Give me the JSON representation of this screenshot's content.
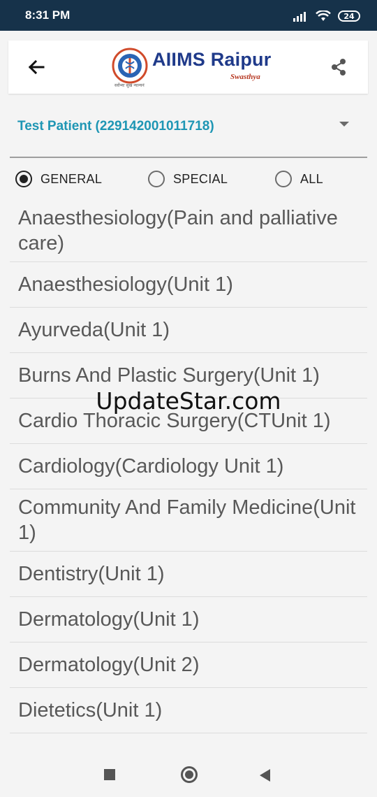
{
  "status_bar": {
    "time": "8:31 PM",
    "battery": "24"
  },
  "header": {
    "logo_title": "AIIMS Raipur",
    "logo_subtitle": "Swasthya",
    "logo_tagline": "सर्वेभ्यः सुखं न्यान्यनं"
  },
  "patient": {
    "selected": "Test Patient (229142001011718)"
  },
  "filter": {
    "options": [
      {
        "label": "GENERAL",
        "checked": true
      },
      {
        "label": "SPECIAL",
        "checked": false
      },
      {
        "label": "ALL",
        "checked": false
      }
    ]
  },
  "departments": [
    "Anaesthesiology(Pain and palliative care)",
    "Anaesthesiology(Unit 1)",
    "Ayurveda(Unit 1)",
    "Burns And Plastic Surgery(Unit 1)",
    "Cardio Thoracic Surgery(CTUnit 1)",
    "Cardiology(Cardiology Unit 1)",
    "Community And Family Medicine(Unit 1)",
    "Dentistry(Unit 1)",
    "Dermatology(Unit 1)",
    "Dermatology(Unit 2)",
    "Dietetics(Unit 1)"
  ],
  "watermark": "UpdateStar.com",
  "colors": {
    "status_bar": "#16324a",
    "accent": "#1e96b4",
    "logo_blue": "#1f3a8a"
  }
}
